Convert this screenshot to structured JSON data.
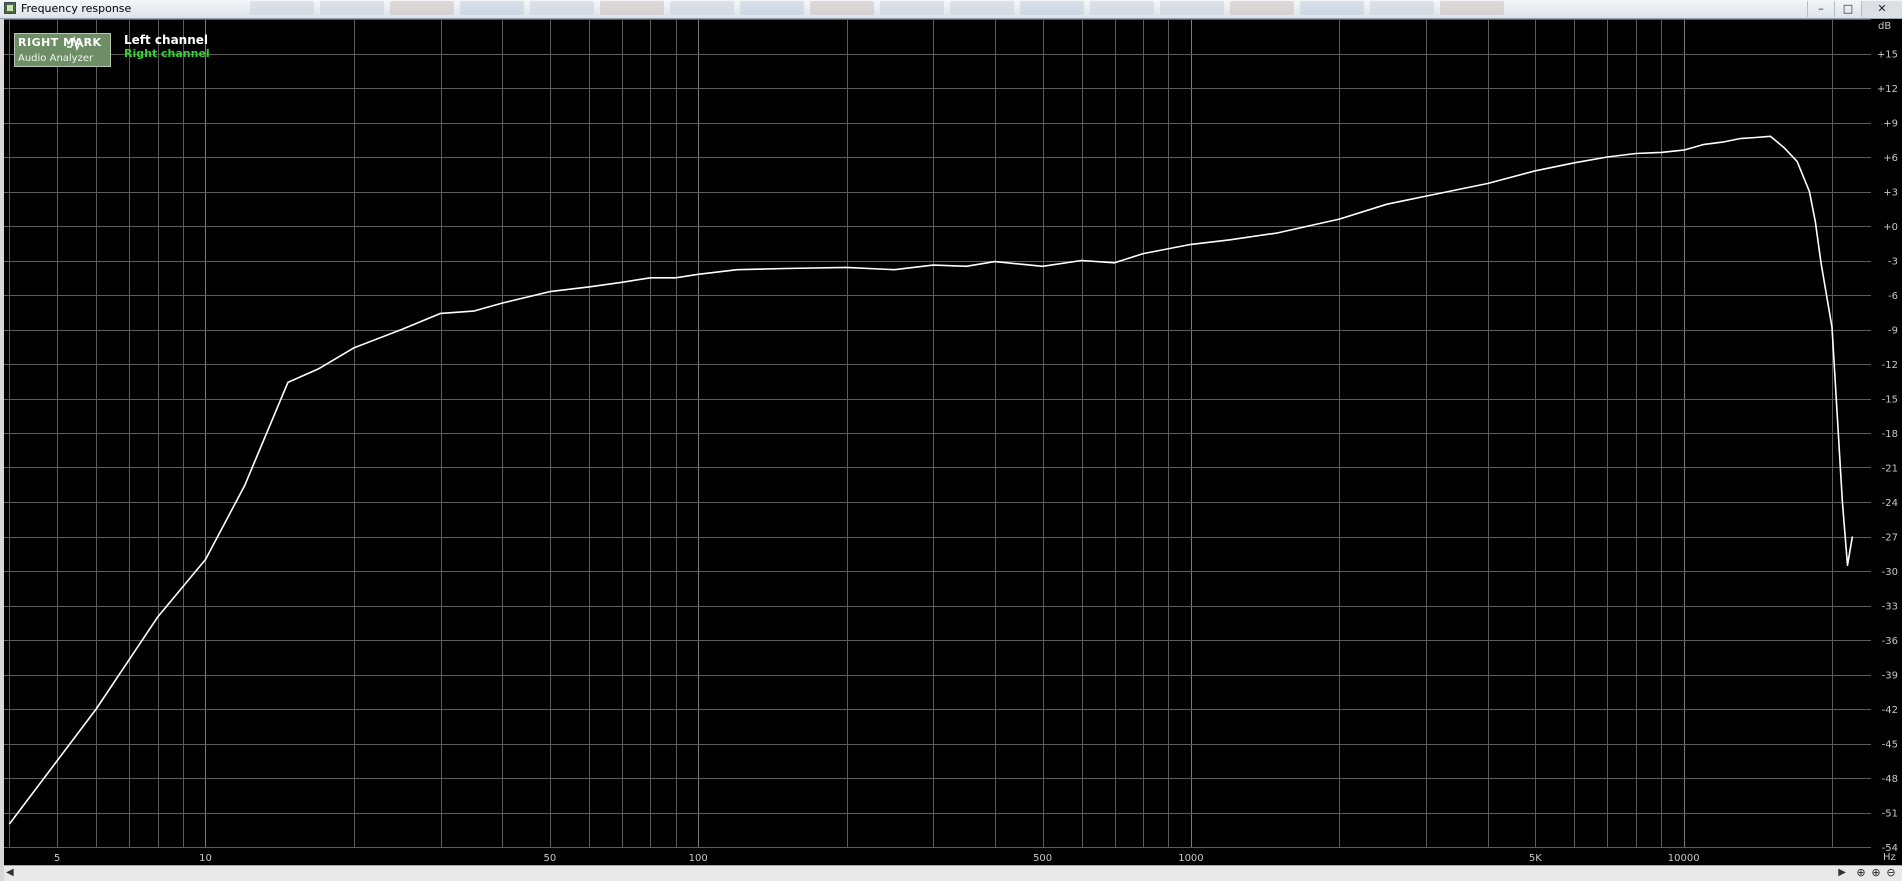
{
  "window": {
    "title": "Frequency response",
    "minimize_label": "–",
    "maximize_label": "□",
    "close_label": "✕"
  },
  "logo": {
    "top_text": "RIGHT MARK",
    "bottom_text": "Audio Analyzer"
  },
  "legend": {
    "left": "Left channel",
    "right": "Right channel"
  },
  "colors": {
    "background": "#000000",
    "grid": "#5c5c5c",
    "left_channel": "#ffffff",
    "right_channel": "#31d431",
    "axis_text": "#c8c8c8"
  },
  "scrollbar": {
    "left_arrow": "◀",
    "right_arrow": "▶",
    "zoom_reset_icon": "zoom-reset-icon",
    "zoom_in_icon": "zoom-in-icon",
    "zoom_out_icon": "zoom-out-icon"
  },
  "chart_data": {
    "type": "line",
    "title": "",
    "xlabel": "Hz",
    "ylabel": "dB",
    "xscale": "log",
    "xlim": [
      3.9,
      24000
    ],
    "ylim": [
      -54,
      18
    ],
    "grid": true,
    "legend_position": "top-left",
    "x_ticks": [
      {
        "value": 5,
        "label": "5"
      },
      {
        "value": 10,
        "label": "10"
      },
      {
        "value": 50,
        "label": "50"
      },
      {
        "value": 100,
        "label": "100"
      },
      {
        "value": 500,
        "label": "500"
      },
      {
        "value": 1000,
        "label": "1000"
      },
      {
        "value": 5000,
        "label": "5K"
      },
      {
        "value": 10000,
        "label": "10000"
      }
    ],
    "y_ticks": [
      {
        "value": 15,
        "label": "+15"
      },
      {
        "value": 12,
        "label": "+12"
      },
      {
        "value": 9,
        "label": "+9"
      },
      {
        "value": 6,
        "label": "+6"
      },
      {
        "value": 3,
        "label": "+3"
      },
      {
        "value": 0,
        "label": "+0"
      },
      {
        "value": -3,
        "label": "-3"
      },
      {
        "value": -6,
        "label": "-6"
      },
      {
        "value": -9,
        "label": "-9"
      },
      {
        "value": -12,
        "label": "-12"
      },
      {
        "value": -15,
        "label": "-15"
      },
      {
        "value": -18,
        "label": "-18"
      },
      {
        "value": -21,
        "label": "-21"
      },
      {
        "value": -24,
        "label": "-24"
      },
      {
        "value": -27,
        "label": "-27"
      },
      {
        "value": -30,
        "label": "-30"
      },
      {
        "value": -33,
        "label": "-33"
      },
      {
        "value": -36,
        "label": "-36"
      },
      {
        "value": -39,
        "label": "-39"
      },
      {
        "value": -42,
        "label": "-42"
      },
      {
        "value": -45,
        "label": "-45"
      },
      {
        "value": -48,
        "label": "-48"
      },
      {
        "value": -51,
        "label": "-51"
      },
      {
        "value": -54,
        "label": "-54"
      }
    ],
    "series": [
      {
        "name": "Left channel",
        "x": [
          4,
          6,
          8,
          10,
          12,
          14.7,
          17,
          20,
          25,
          30,
          35,
          40,
          50,
          60,
          70,
          80,
          90,
          100,
          120,
          150,
          200,
          250,
          300,
          350,
          400,
          500,
          600,
          700,
          800,
          1000,
          1200,
          1500,
          2000,
          2500,
          3000,
          4000,
          5000,
          6000,
          7000,
          8000,
          9000,
          10000,
          11000,
          12000,
          13000,
          14000,
          15000,
          16000,
          17000,
          18000,
          18500,
          19000,
          20000,
          21000,
          21500,
          22000
        ],
        "y": [
          -52,
          -42,
          -34,
          -29,
          -22.6,
          -13.6,
          -12.4,
          -10.6,
          -9.0,
          -7.6,
          -7.4,
          -6.7,
          -5.7,
          -5.3,
          -4.9,
          -4.5,
          -4.5,
          -4.2,
          -3.8,
          -3.7,
          -3.6,
          -3.8,
          -3.4,
          -3.5,
          -3.1,
          -3.5,
          -3.0,
          -3.2,
          -2.4,
          -1.6,
          -1.2,
          -0.6,
          0.6,
          1.9,
          2.6,
          3.7,
          4.8,
          5.5,
          6.0,
          6.3,
          6.4,
          6.6,
          7.1,
          7.3,
          7.6,
          7.7,
          7.8,
          6.8,
          5.6,
          3.0,
          0.4,
          -3.2,
          -8.8,
          -24.0,
          -29.5,
          -27.0
        ]
      }
    ]
  }
}
